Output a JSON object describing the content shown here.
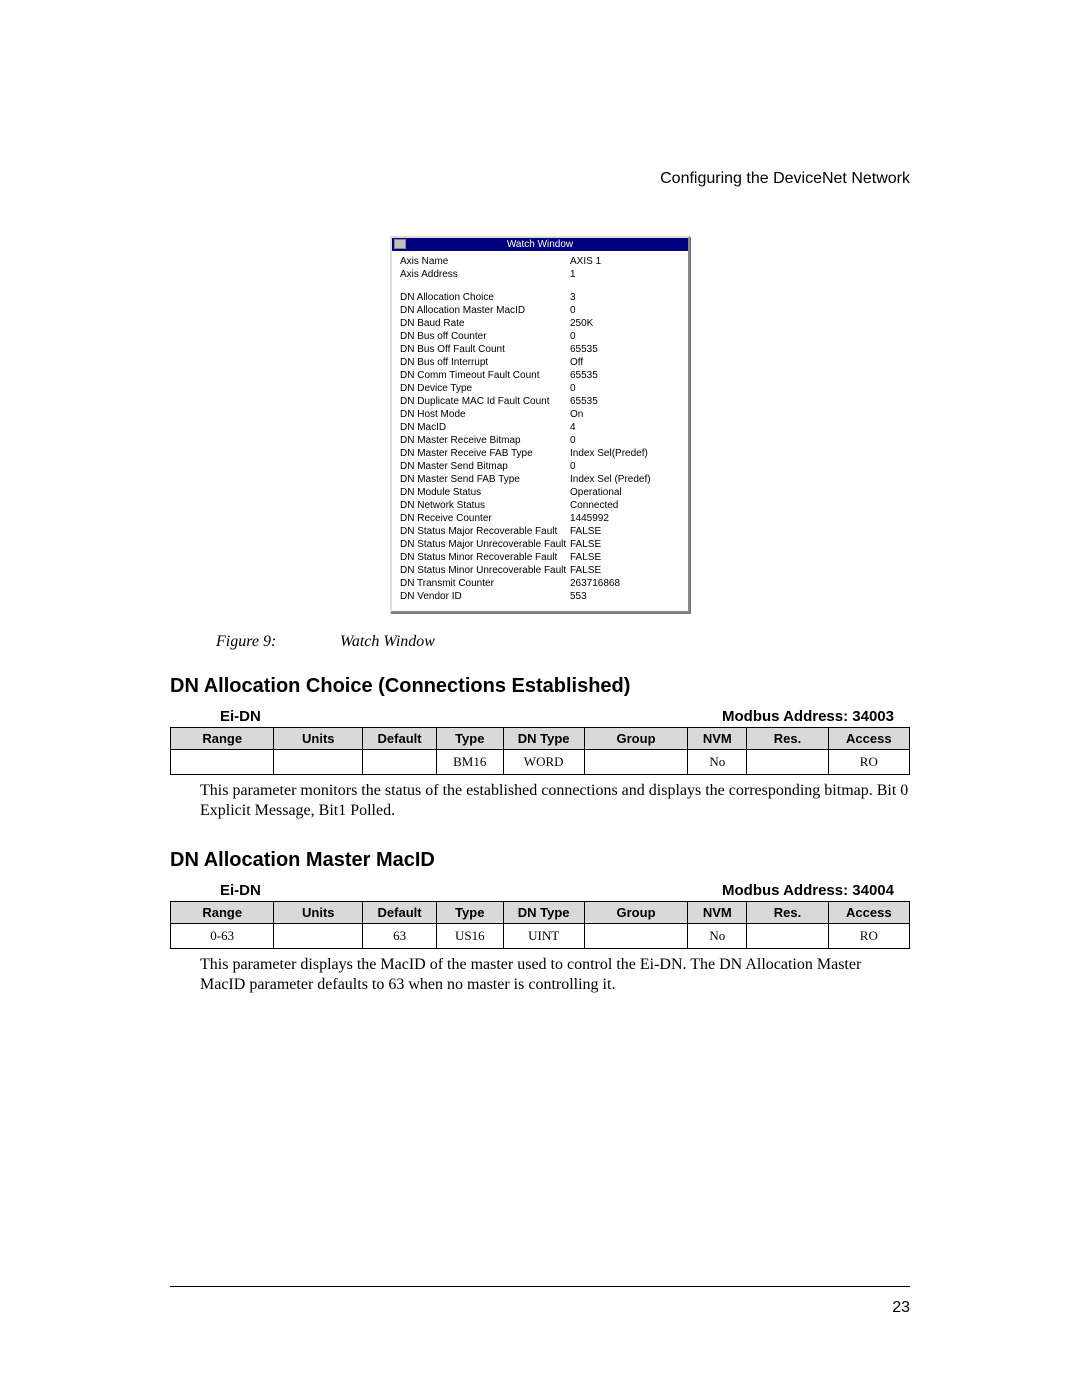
{
  "header": "Configuring the DeviceNet Network",
  "watch_window": {
    "title": "Watch Window",
    "top_rows": [
      {
        "label": "Axis Name",
        "value": "AXIS 1"
      },
      {
        "label": "Axis Address",
        "value": "1"
      }
    ],
    "rows": [
      {
        "label": "DN Allocation Choice",
        "value": "3"
      },
      {
        "label": "DN Allocation Master MacID",
        "value": "0"
      },
      {
        "label": "DN Baud Rate",
        "value": "250K"
      },
      {
        "label": "DN Bus off Counter",
        "value": "0"
      },
      {
        "label": "DN Bus Off Fault Count",
        "value": "65535"
      },
      {
        "label": "DN Bus off Interrupt",
        "value": "Off"
      },
      {
        "label": "DN Comm Timeout Fault Count",
        "value": "65535"
      },
      {
        "label": "DN Device Type",
        "value": "0"
      },
      {
        "label": "DN Duplicate MAC Id Fault Count",
        "value": "65535"
      },
      {
        "label": "DN Host Mode",
        "value": "On"
      },
      {
        "label": "DN MacID",
        "value": "4"
      },
      {
        "label": "DN Master Receive Bitmap",
        "value": "0"
      },
      {
        "label": "DN Master Receive FAB Type",
        "value": "Index Sel(Predef)"
      },
      {
        "label": "DN Master Send Bitmap",
        "value": "0"
      },
      {
        "label": "DN Master Send FAB Type",
        "value": "Index Sel (Predef)"
      },
      {
        "label": "DN Module Status",
        "value": "Operational"
      },
      {
        "label": "DN Network Status",
        "value": "Connected"
      },
      {
        "label": "DN Receive Counter",
        "value": "1445992"
      },
      {
        "label": "DN Status Major Recoverable Fault",
        "value": "FALSE"
      },
      {
        "label": "DN Status Major Unrecoverable Fault",
        "value": "FALSE"
      },
      {
        "label": "DN Status Minor Recoverable Fault",
        "value": "FALSE"
      },
      {
        "label": "DN Status Minor Unrecoverable Fault",
        "value": "FALSE"
      },
      {
        "label": "DN Transmit Counter",
        "value": "263716868"
      },
      {
        "label": "DN Vendor ID",
        "value": "553"
      }
    ]
  },
  "figure": {
    "number": "Figure 9:",
    "title": "Watch Window"
  },
  "section1": {
    "title": "DN Allocation Choice (Connections Established)",
    "sub_left": "Ei-DN",
    "sub_right": "Modbus Address: 34003",
    "headers": [
      "Range",
      "Units",
      "Default",
      "Type",
      "DN Type",
      "Group",
      "NVM",
      "Res.",
      "Access"
    ],
    "row": {
      "range": "",
      "units": "",
      "default": "",
      "type": "BM16",
      "dntype": "WORD",
      "group": "",
      "nvm": "No",
      "res": "",
      "access": "RO"
    },
    "desc": "This parameter monitors the status of the established connections and displays the corresponding bitmap.  Bit 0 Explicit Message, Bit1 Polled."
  },
  "section2": {
    "title": "DN Allocation Master MacID",
    "sub_left": "Ei-DN",
    "sub_right": "Modbus Address: 34004",
    "headers": [
      "Range",
      "Units",
      "Default",
      "Type",
      "DN Type",
      "Group",
      "NVM",
      "Res.",
      "Access"
    ],
    "row": {
      "range": "0-63",
      "units": "",
      "default": "63",
      "type": "US16",
      "dntype": "UINT",
      "group": "",
      "nvm": "No",
      "res": "",
      "access": "RO"
    },
    "desc": "This parameter displays the MacID of the master used to control the Ei-DN.  The DN Allocation Master MacID parameter defaults to 63 when no master is controlling it."
  },
  "page_number": "23"
}
